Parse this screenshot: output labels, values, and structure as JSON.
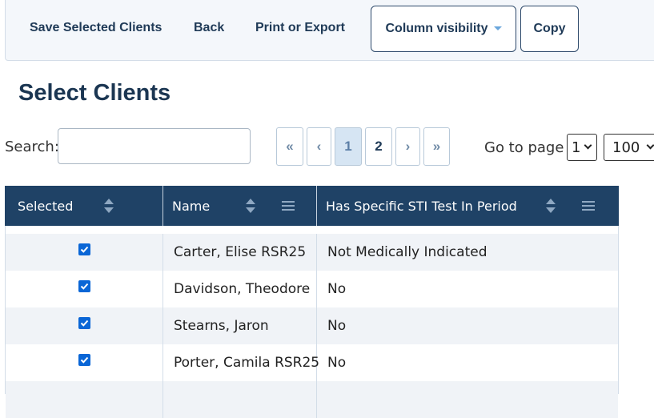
{
  "toolbar": {
    "save_selected": "Save Selected Clients",
    "back": "Back",
    "print_export": "Print or Export",
    "column_visibility": "Column visibility",
    "copy": "Copy"
  },
  "page": {
    "title": "Select Clients"
  },
  "search": {
    "label": "Search:",
    "value": "",
    "placeholder": ""
  },
  "pagination": {
    "first": "«",
    "prev": "‹",
    "pages": [
      "1",
      "2"
    ],
    "active_page": "1",
    "next": "›",
    "last": "»",
    "goto_label": "Go to page",
    "goto_value": "1",
    "page_size": "100"
  },
  "table": {
    "columns": [
      "Selected",
      "Name",
      "Has Specific STI Test In Period"
    ],
    "rows": [
      {
        "selected": true,
        "name": "Carter, Elise RSR25",
        "sti": "Not Medically Indicated"
      },
      {
        "selected": true,
        "name": "Davidson, Theodore",
        "sti": "No"
      },
      {
        "selected": true,
        "name": "Stearns, Jaron",
        "sti": "No"
      },
      {
        "selected": true,
        "name": "Porter, Camila RSR25",
        "sti": "No"
      },
      {
        "selected": true,
        "name": "",
        "sti": ""
      }
    ]
  },
  "colors": {
    "header_bg": "#1f4266",
    "accent": "#0a66d6",
    "row_alt": "#f0f3f7"
  }
}
